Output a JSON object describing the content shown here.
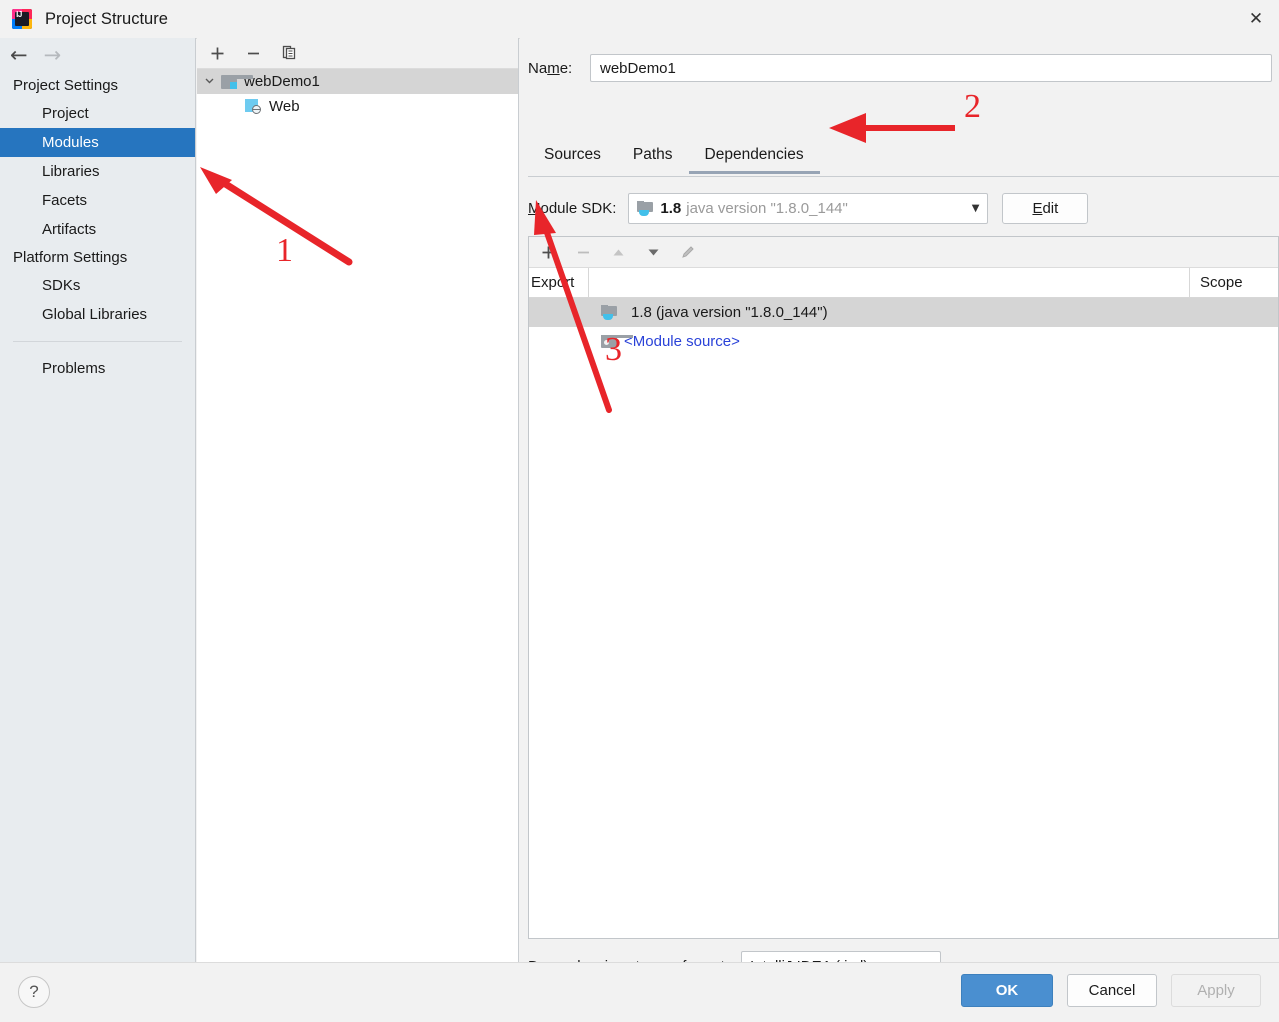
{
  "window": {
    "title": "Project Structure",
    "app_icon": "intellij-idea-icon",
    "close_label": "✕"
  },
  "sidebar": {
    "nav_back": "←",
    "nav_forward": "→",
    "groups": [
      {
        "title": "Project Settings",
        "items": [
          {
            "label": "Project",
            "selected": false
          },
          {
            "label": "Modules",
            "selected": true
          },
          {
            "label": "Libraries",
            "selected": false
          },
          {
            "label": "Facets",
            "selected": false
          },
          {
            "label": "Artifacts",
            "selected": false
          }
        ]
      },
      {
        "title": "Platform Settings",
        "items": [
          {
            "label": "SDKs",
            "selected": false
          },
          {
            "label": "Global Libraries",
            "selected": false
          }
        ]
      }
    ],
    "problems": {
      "label": "Problems"
    },
    "selected_color": "#2675bf"
  },
  "tree": {
    "toolbar": {
      "add": "+",
      "remove": "−",
      "copy": "copy-icon"
    },
    "nodes": [
      {
        "label": "webDemo1",
        "icon": "module-folder-icon",
        "expanded": true,
        "selected": true,
        "chevron": "∨"
      },
      {
        "label": "Web",
        "icon": "web-facet-icon",
        "selected": false
      }
    ]
  },
  "module": {
    "name_label": "Name:",
    "name_label_prefix": "Na",
    "name_label_mnemonic": "m",
    "name_label_suffix": "e:",
    "name_value": "webDemo1",
    "tabs": [
      {
        "label": "Sources",
        "active": false
      },
      {
        "label": "Paths",
        "active": false
      },
      {
        "label": "Dependencies",
        "active": true
      }
    ],
    "tab_underline_color": "#97a4b5"
  },
  "sdk": {
    "label_prefix": "",
    "label_mnemonic": "M",
    "label_suffix": "odule SDK:",
    "label": "Module SDK:",
    "version": "1.8",
    "description": "java version \"1.8.0_144\"",
    "dropdown_arrow": "▼",
    "edit_button": "Edit",
    "edit_mnemonic": "E",
    "edit_rest": "dit"
  },
  "dependencies": {
    "toolbar": {
      "add": "+",
      "remove": "−",
      "move_up": "▲",
      "move_down": "▼",
      "edit": "pencil-icon"
    },
    "columns": [
      "Export",
      "",
      "Scope"
    ],
    "rows": [
      {
        "export": "",
        "icon": "jdk-icon",
        "label": "1.8 (java version \"1.8.0_144\")",
        "scope": "",
        "selected": true,
        "is_link": false
      },
      {
        "export": "",
        "icon": "module-source-icon",
        "label": "<Module source>",
        "scope": "",
        "selected": false,
        "is_link": true
      }
    ],
    "link_color": "#2a42d8"
  },
  "storage": {
    "label": "Dependencies storage format:",
    "value": "IntelliJ IDEA (.iml)",
    "dropdown_arrow": "▼"
  },
  "footer": {
    "help": "?",
    "ok": "OK",
    "cancel": "Cancel",
    "apply": "Apply",
    "ok_color": "#4a8fd0"
  },
  "annotations": {
    "color": "#e8252a",
    "marks": [
      {
        "number": "1",
        "points_to": "sidebar-item-modules"
      },
      {
        "number": "2",
        "points_to": "tab-dependencies"
      },
      {
        "number": "3",
        "points_to": "dependencies-add-button"
      }
    ]
  }
}
